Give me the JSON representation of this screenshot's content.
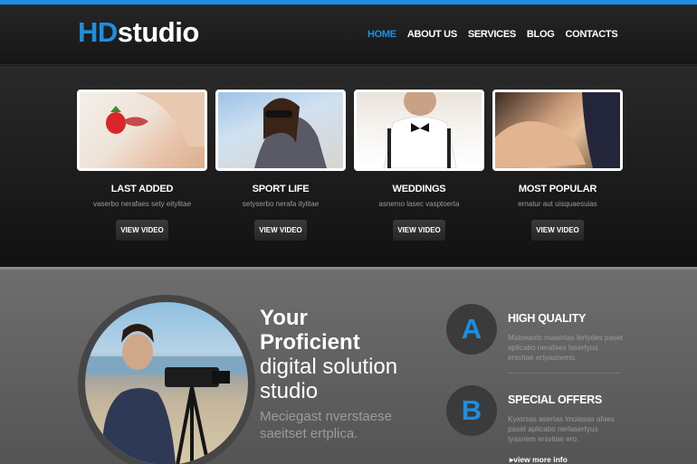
{
  "brand": {
    "logo_part1": "HD",
    "logo_part2": "studio",
    "accent": "#1c8fe0"
  },
  "nav": {
    "items": [
      {
        "label": "HOME",
        "active": true
      },
      {
        "label": "ABOUT US",
        "active": false
      },
      {
        "label": "SERVICES",
        "active": false
      },
      {
        "label": "BLOG",
        "active": false
      },
      {
        "label": "CONTACTS",
        "active": false
      }
    ]
  },
  "gallery": {
    "cards": [
      {
        "title": "LAST ADDED",
        "subtitle": "vaserbo nerafaes sety eitylitae",
        "button": "VIEW VIDEO"
      },
      {
        "title": "SPORT LIFE",
        "subtitle": "setyserbo nerafa itylitae",
        "button": "VIEW VIDEO"
      },
      {
        "title": "WEDDINGS",
        "subtitle": "asnemo lasec vasptoerta",
        "button": "VIEW VIDEO"
      },
      {
        "title": "MOST POPULAR",
        "subtitle": "ernatur aut uisquaesuias",
        "button": "VIEW VIDEO"
      }
    ]
  },
  "hero": {
    "line1": "Your",
    "line2": "Proficient",
    "line3": "digital solution",
    "line4": "studio",
    "tagline": "Meciegast nverstaese saeitset ertplica."
  },
  "features": [
    {
      "badge": "A",
      "title": "HIGH QUALITY",
      "text": "Matseants masertas lertydes paset aplicabo nerafaes lasertyus ersvitae ertyasnemo."
    },
    {
      "badge": "B",
      "title": "SPECIAL OFFERS",
      "text": "Kyatrsas asertas lmoiasas afaes paset aplicabo nerlasertyus tyasnem ersvitae ero."
    }
  ],
  "more_link": "view more info"
}
